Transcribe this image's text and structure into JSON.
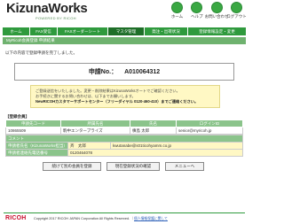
{
  "header": {
    "logo": "KizunaWorks",
    "tagline": "POWERED BY RICOH",
    "icons": [
      {
        "label": "ホーム"
      },
      {
        "label": "ヘルプ"
      },
      {
        "label": "お問い合わせ"
      },
      {
        "label": "ログアウト"
      }
    ]
  },
  "nav": {
    "tabs": [
      {
        "label": "ホーム"
      },
      {
        "label": "FAX受信"
      },
      {
        "label": "FAXオーダーシート"
      },
      {
        "label": "マスタ管理"
      },
      {
        "label": "発注・出荷状況"
      },
      {
        "label": "登録情報設定・変更"
      }
    ]
  },
  "breadcrumb": "MyRicoh会員登録 申請結果",
  "notice": "以下の内容で登録申請を完了しました。",
  "application": {
    "label": "申請No.：",
    "value": "A010064312"
  },
  "message": {
    "line1": "ご登録送信をいたしました。変更・削除結果はKizunaWorksオートでご確認ください。",
    "line2": "お手続きに関するお問い合わせは、以下までお願いします。",
    "line3": "NewRICOHカスタマーサポートセンター（フリーダイヤル 0120-460-410）までご連絡ください。"
  },
  "section_title": "【登録会員】",
  "members_table": {
    "headers": [
      "申請先コード",
      "所属先名",
      "氏名",
      "ログインID"
    ],
    "rows": [
      [
        "10865509",
        "駒中エンタープライズ",
        "槙島 太郎",
        "senior@myricoh.jp"
      ]
    ]
  },
  "applicant": {
    "comment_label": "コメント",
    "name_label": "申請者氏名（KizunaWorks担当）",
    "name_value": "斉　太郎",
    "email_value": "kwutanabe@s01ticohyamm.co.jp",
    "phone_label": "申請者連絡先電話番号",
    "phone_value": "0120464078"
  },
  "buttons": {
    "back": "続けて別の会員を登録",
    "status": "現在登録状況の確認",
    "menu": "メニューへ"
  },
  "footer": {
    "brand": "RICOH",
    "copyright": "Copyright 2017 RICOH JAPAN Corporation All Rights Reserved.",
    "link": "個人情報保護に関して"
  }
}
